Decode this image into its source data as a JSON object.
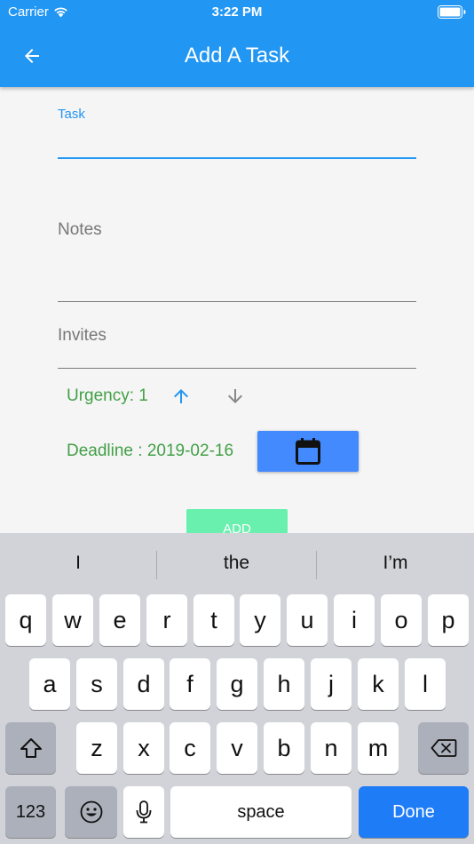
{
  "status_bar": {
    "carrier": "Carrier",
    "time": "3:22 PM"
  },
  "app_bar": {
    "title": "Add A Task",
    "back_icon": "arrow-left-icon",
    "color": "#2196f3"
  },
  "form": {
    "task_label": "Task",
    "notes_label": "Notes",
    "invites_label": "Invites",
    "urgency_label": "Urgency: 1",
    "deadline_label": "Deadline : 2019-02-16",
    "add_button": "ADD",
    "accent_color": "#2196f3",
    "green_color": "#43a047"
  },
  "keyboard": {
    "suggestions": [
      "I",
      "the",
      "I’m"
    ],
    "row1": [
      "q",
      "w",
      "e",
      "r",
      "t",
      "y",
      "u",
      "i",
      "o",
      "p"
    ],
    "row2": [
      "a",
      "s",
      "d",
      "f",
      "g",
      "h",
      "j",
      "k",
      "l"
    ],
    "row3": [
      "z",
      "x",
      "c",
      "v",
      "b",
      "n",
      "m"
    ],
    "numbers_key": "123",
    "space_key": "space",
    "done_key": "Done"
  }
}
